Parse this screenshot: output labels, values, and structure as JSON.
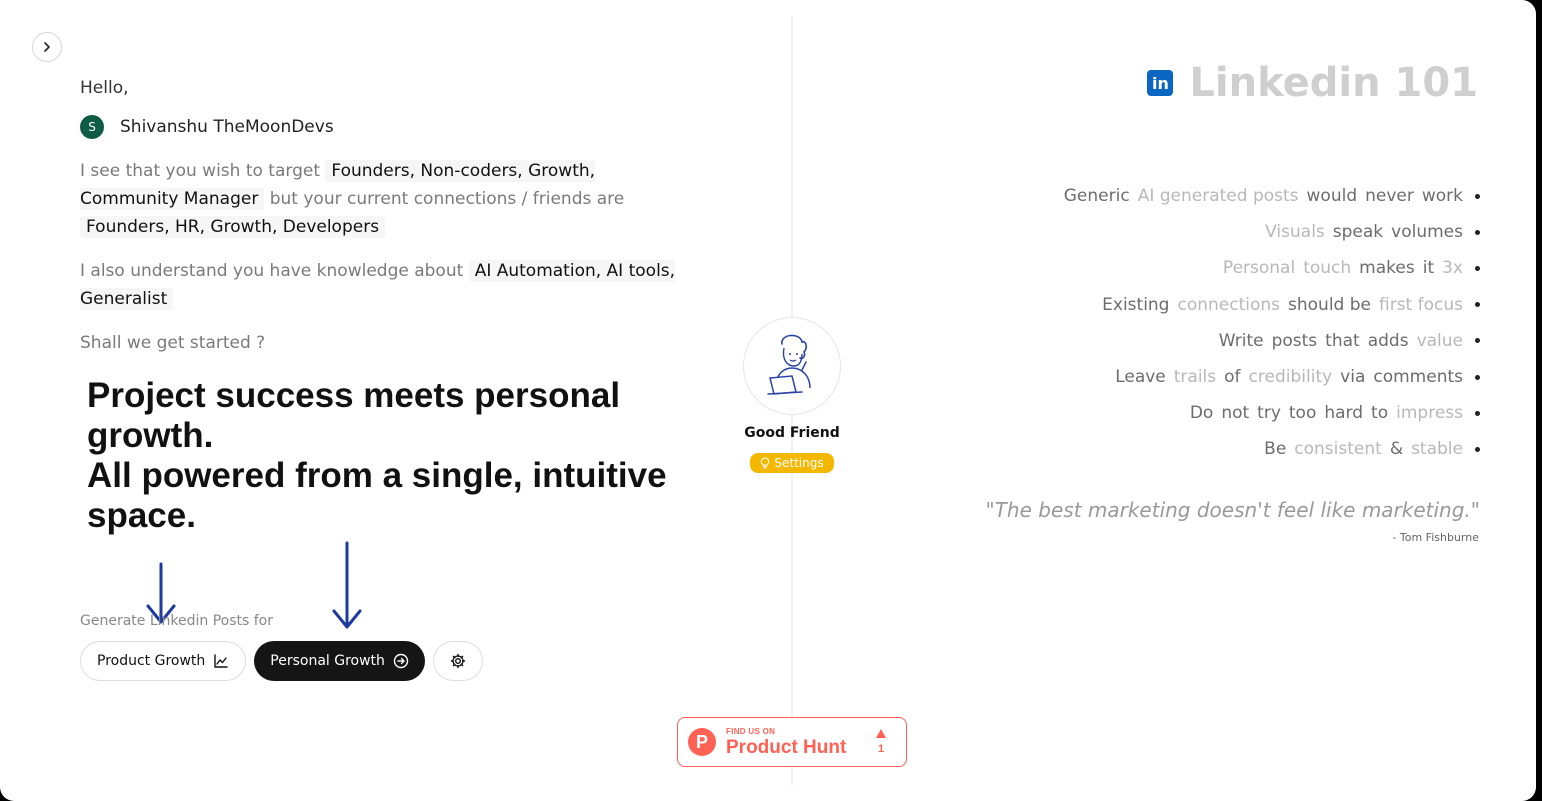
{
  "greeting": "Hello,",
  "user": {
    "initial": "S",
    "name": "Shivanshu TheMoonDevs"
  },
  "intro": {
    "target_prefix": "I see that you wish to target",
    "target_value": "Founders, Non-coders, Growth, Community Manager",
    "connections_prefix": "but your current connections / friends are",
    "connections_value": "Founders, HR, Growth, Developers",
    "knowledge_prefix": "I also understand you have knowledge about",
    "knowledge_value": "AI Automation, AI tools, Generalist",
    "cta": "Shall we get started ?"
  },
  "headline": {
    "line1": "Project success meets personal growth.",
    "line2": "All powered from a single, intuitive space."
  },
  "generate": {
    "label": "Generate Linkedin Posts for",
    "product_growth": "Product Growth",
    "personal_growth": "Personal Growth"
  },
  "friend": {
    "name": "Good Friend",
    "settings": "Settings"
  },
  "product_hunt": {
    "find_us": "FIND US ON",
    "name": "Product Hunt",
    "votes": "1"
  },
  "right": {
    "icon_text": "in",
    "title": "Linkedin 101",
    "tips": [
      [
        [
          "Generic",
          "d"
        ],
        [
          "AI generated posts",
          "l"
        ],
        [
          "would",
          "d"
        ],
        [
          "never",
          "d"
        ],
        [
          "work",
          "d"
        ]
      ],
      [
        [
          "Visuals",
          "l"
        ],
        [
          "speak",
          "d"
        ],
        [
          "volumes",
          "d"
        ]
      ],
      [
        [
          "Personal",
          "l"
        ],
        [
          "touch",
          "l"
        ],
        [
          "makes",
          "d"
        ],
        [
          "it",
          "d"
        ],
        [
          "3x",
          "l"
        ]
      ],
      [
        [
          "Existing",
          "d"
        ],
        [
          "connections",
          "l"
        ],
        [
          "should be",
          "d"
        ],
        [
          "first focus",
          "l"
        ]
      ],
      [
        [
          "Write",
          "d"
        ],
        [
          "posts",
          "d"
        ],
        [
          "that",
          "d"
        ],
        [
          "adds",
          "d"
        ],
        [
          "value",
          "l"
        ]
      ],
      [
        [
          "Leave",
          "d"
        ],
        [
          "trails",
          "l"
        ],
        [
          "of",
          "d"
        ],
        [
          "credibility",
          "l"
        ],
        [
          "via",
          "d"
        ],
        [
          "comments",
          "d"
        ]
      ],
      [
        [
          "Do",
          "d"
        ],
        [
          "not",
          "d"
        ],
        [
          "try",
          "d"
        ],
        [
          "too",
          "d"
        ],
        [
          "hard",
          "d"
        ],
        [
          "to",
          "d"
        ],
        [
          "impress",
          "l"
        ]
      ],
      [
        [
          "Be",
          "d"
        ],
        [
          "consistent",
          "l"
        ],
        [
          "&",
          "d"
        ],
        [
          "stable",
          "l"
        ]
      ]
    ],
    "quote": "\"The best marketing doesn't feel like marketing.\"",
    "author": "- Tom Fishburne"
  },
  "colors": {
    "accent_dark": "#151515",
    "linkedin": "#0a66c2",
    "settings": "#f5b800",
    "product_hunt": "#ff6154",
    "avatar": "#0f5b45",
    "arrow": "#1f3a9e"
  }
}
